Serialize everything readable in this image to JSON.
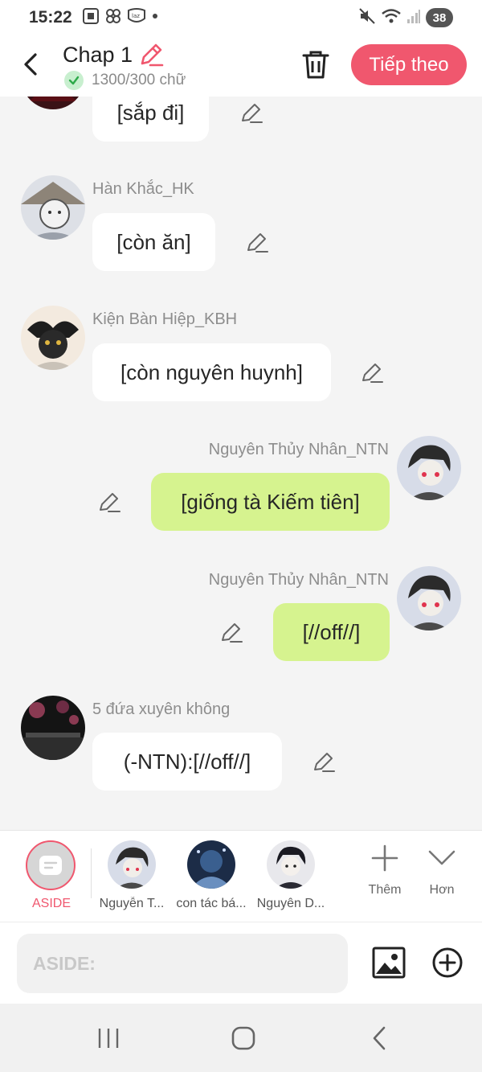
{
  "status_bar": {
    "time": "15:22",
    "battery": "38",
    "left_icons": [
      "screenshot-icon",
      "pinwheel-icon",
      "lazada-icon",
      "notification-dot-icon"
    ],
    "right_icons": [
      "mute-icon",
      "wifi-icon",
      "signal-icon",
      "battery-icon"
    ]
  },
  "header": {
    "title": "Chap 1",
    "word_count": "1300/300 chữ",
    "next_label": "Tiếp theo",
    "accent_color": "#f0576e"
  },
  "messages": [
    {
      "sender": "",
      "text": "[sắp đi]",
      "mine": false
    },
    {
      "sender": "Hàn Khắc_HK",
      "text": "[còn ăn]",
      "mine": false
    },
    {
      "sender": "Kiện Bàn Hiệp_KBH",
      "text": "[còn nguyên huynh]",
      "mine": false
    },
    {
      "sender": "Nguyên Thủy Nhân_NTN",
      "text": "[giống tà Kiếm tiên]",
      "mine": true
    },
    {
      "sender": "Nguyên Thủy Nhân_NTN",
      "text": "[//off//]",
      "mine": true
    },
    {
      "sender": "5 đứa xuyên không",
      "text": "(-NTN):[//off//]",
      "mine": false
    }
  ],
  "character_bar": {
    "aside_label": "ASIDE",
    "characters": [
      {
        "label": "Nguyễn T..."
      },
      {
        "label": "con tác bá..."
      },
      {
        "label": "Nguyên D..."
      }
    ],
    "add_label": "Thêm",
    "more_label": "Hơn"
  },
  "input": {
    "placeholder": "ASIDE:"
  },
  "colors": {
    "bubble_mine": "#d6f38f",
    "bubble_other": "#ffffff",
    "background": "#f4f4f4"
  }
}
